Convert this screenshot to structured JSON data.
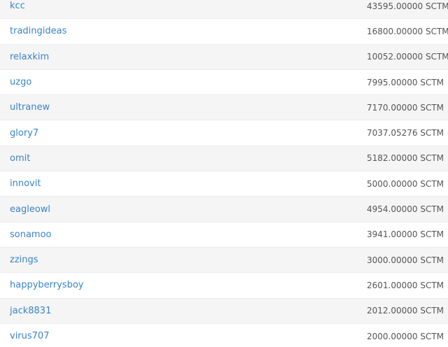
{
  "rows": [
    {
      "user": "kcc",
      "amount": "43595.00000 SCTM"
    },
    {
      "user": "tradingideas",
      "amount": "16800.00000 SCTM"
    },
    {
      "user": "relaxkim",
      "amount": "10052.00000 SCTM"
    },
    {
      "user": "uzgo",
      "amount": "7995.00000 SCTM"
    },
    {
      "user": "ultranew",
      "amount": "7170.00000 SCTM"
    },
    {
      "user": "glory7",
      "amount": "7037.05276 SCTM"
    },
    {
      "user": "omit",
      "amount": "5182.00000 SCTM"
    },
    {
      "user": "innovit",
      "amount": "5000.00000 SCTM"
    },
    {
      "user": "eagleowl",
      "amount": "4954.00000 SCTM"
    },
    {
      "user": "sonamoo",
      "amount": "3941.00000 SCTM"
    },
    {
      "user": "zzings",
      "amount": "3000.00000 SCTM"
    },
    {
      "user": "happyberrysboy",
      "amount": "2601.00000 SCTM"
    },
    {
      "user": "jack8831",
      "amount": "2012.00000 SCTM"
    },
    {
      "user": "virus707",
      "amount": "2000.00000 SCTM"
    }
  ],
  "colors": {
    "link": "#3a83c8",
    "amount_text": "#555555",
    "row_odd": "#f5f5f5",
    "row_even": "#ffffff"
  }
}
